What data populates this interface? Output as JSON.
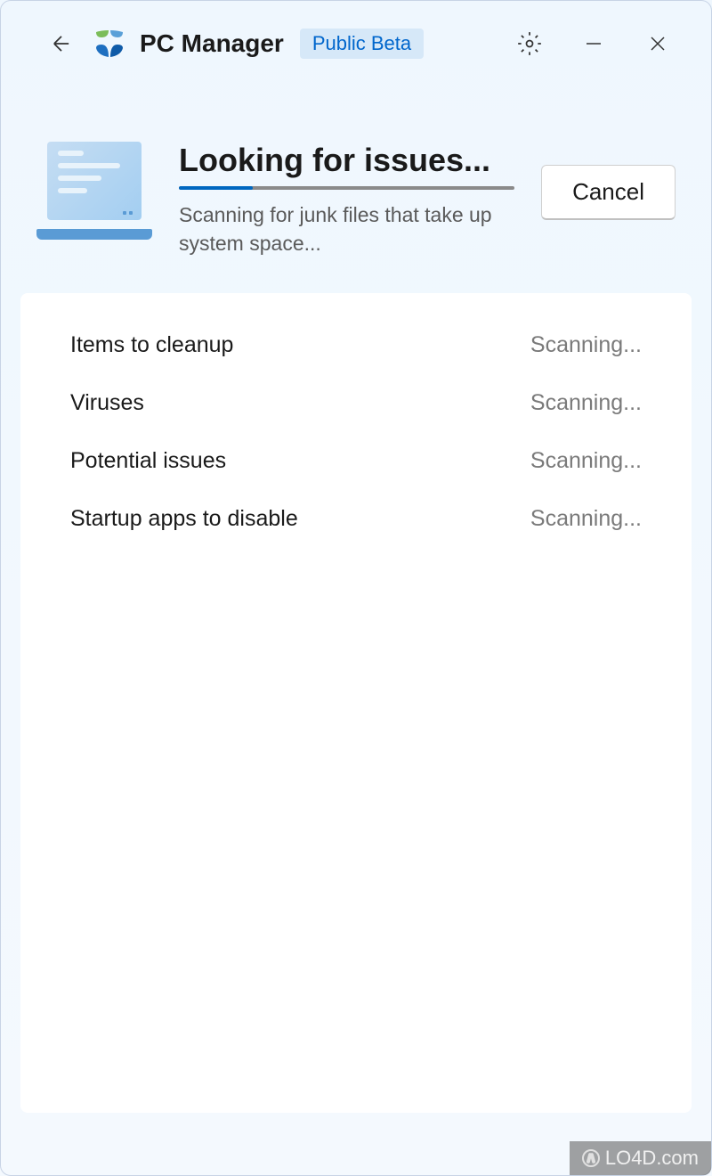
{
  "header": {
    "app_title": "PC Manager",
    "beta_label": "Public Beta"
  },
  "scan": {
    "title": "Looking for issues...",
    "subtitle": "Scanning for junk files that take up system space...",
    "cancel_label": "Cancel",
    "progress_percent": 22
  },
  "items": [
    {
      "label": "Items to cleanup",
      "status": "Scanning..."
    },
    {
      "label": "Viruses",
      "status": "Scanning..."
    },
    {
      "label": "Potential issues",
      "status": "Scanning..."
    },
    {
      "label": "Startup apps to disable",
      "status": "Scanning..."
    }
  ],
  "watermark": "LO4D.com"
}
